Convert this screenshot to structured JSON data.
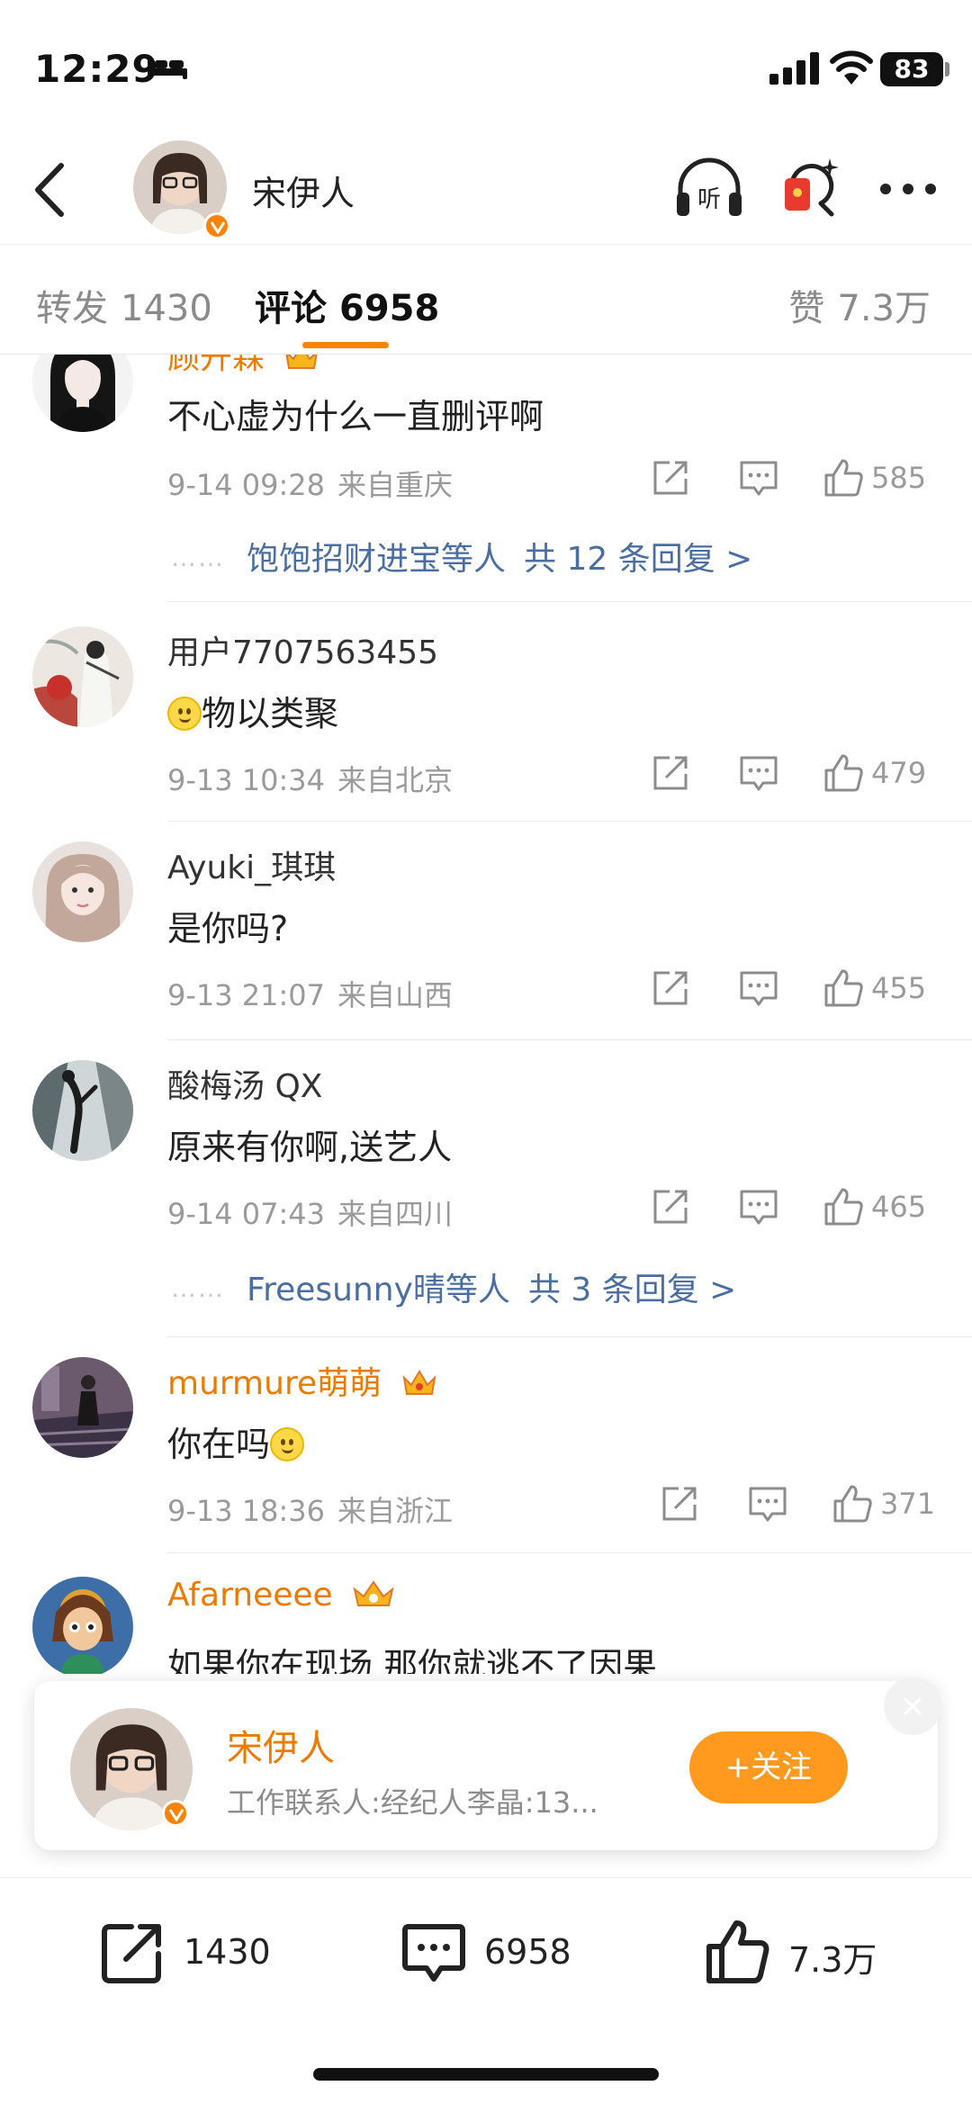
{
  "status_bar": {
    "time": "12:29",
    "battery": "83"
  },
  "header": {
    "user_name": "宋伊人",
    "listen_label": "听"
  },
  "tabs": [
    {
      "label": "转发",
      "count": "1430"
    },
    {
      "label": "评论",
      "count": "6958"
    },
    {
      "label": "赞",
      "count": "7.3万"
    }
  ],
  "comments": [
    {
      "name": "顾开霖",
      "vip": true,
      "text": "不心虚为什么一直删评啊",
      "date": "9-14 09:28",
      "location": "来自重庆",
      "likes": "585",
      "replies": {
        "dots": "……",
        "users": "饱饱招财进宝等人",
        "total": "共 12 条回复 >"
      }
    },
    {
      "name": "用户7707563455",
      "vip": false,
      "text": "物以类聚",
      "emoji_before_text": true,
      "date": "9-13 10:34",
      "location": "来自北京",
      "likes": "479"
    },
    {
      "name": "Ayuki_琪琪",
      "vip": false,
      "text": "是你吗?",
      "date": "9-13 21:07",
      "location": "来自山西",
      "likes": "455"
    },
    {
      "name": "酸梅汤 QX",
      "vip": false,
      "text": "原来有你啊,送艺人",
      "date": "9-14 07:43",
      "location": "来自四川",
      "likes": "465",
      "replies": {
        "dots": "……",
        "users": "Freesunny晴等人",
        "total": "共 3 条回复 >"
      }
    },
    {
      "name": "murmure萌萌",
      "vip": true,
      "text": "你在吗",
      "emoji_after_text": true,
      "date": "9-13 18:36",
      "location": "来自浙江",
      "likes": "371"
    },
    {
      "name": "Afarneeee",
      "vip": true,
      "text": "如果你在现场 那你就逃不了因果"
    }
  ],
  "follow_card": {
    "name": "宋伊人",
    "description": "工作联系人:经纪人李晶:13...",
    "follow_label": "+关注"
  },
  "bottom_bar": {
    "reposts": "1430",
    "comments": "6958",
    "likes": "7.3万"
  },
  "colors": {
    "accent": "#ff8200",
    "vip_name": "#eb7b00",
    "link": "#4a6ea0",
    "meta": "#9a9a9a"
  }
}
